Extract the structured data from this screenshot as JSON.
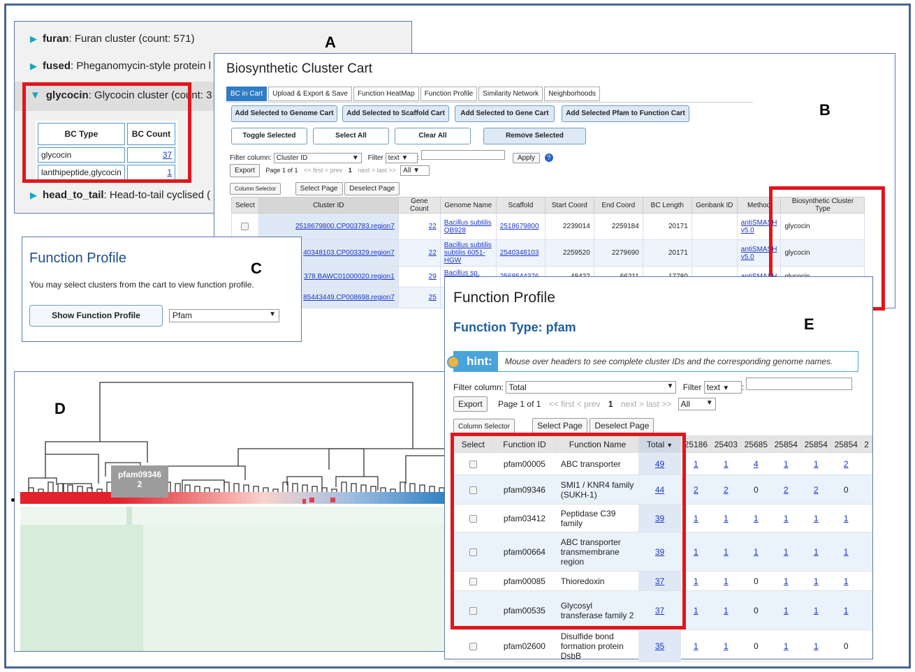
{
  "letters": {
    "a": "A",
    "b": "B",
    "c": "C",
    "d": "D",
    "e": "E"
  },
  "colors": {
    "border": "#4a6690",
    "red": "#e0161c",
    "link": "#1a35c8",
    "accent": "#2f7dc6"
  },
  "panel_a": {
    "rows": [
      {
        "name": "furan",
        "desc": ": Furan cluster (count: 571)"
      },
      {
        "name": "fused",
        "desc": ": Pheganomycin-style protein l"
      },
      {
        "name": "glycocin",
        "desc": ": Glycocin cluster (count: 3"
      },
      {
        "name": "head_to_tail",
        "desc": ": Head-to-tail cyclised ("
      }
    ],
    "table": {
      "headers": [
        "BC Type",
        "BC Count"
      ],
      "rows": [
        [
          "glycocin",
          "37"
        ],
        [
          "lanthipeptide,glycocin",
          "1"
        ]
      ]
    }
  },
  "panel_b": {
    "title": "Biosynthetic Cluster Cart",
    "tabs": [
      "BC in Cart",
      "Upload & Export & Save",
      "Function HeatMap",
      "Function Profile",
      "Similarity Network",
      "Neighborhoods"
    ],
    "buttons": {
      "add_genome": "Add Selected to Genome Cart",
      "add_scaffold": "Add Selected to Scaffold Cart",
      "add_gene": "Add Selected to Gene Cart",
      "add_pfam": "Add Selected Pfam to Function Cart",
      "toggle": "Toggle Selected",
      "select_all": "Select All",
      "clear_all": "Clear All",
      "remove": "Remove Selected"
    },
    "filter": {
      "label": "Filter column:",
      "column": "Cluster ID",
      "filter_label": "Filter",
      "type": "text",
      "apply": "Apply"
    },
    "export": "Export",
    "pager": {
      "page": "Page 1 of 1",
      "first": "<< first",
      "prev": "< prev",
      "num": "1",
      "next": "next >",
      "last": "last >>",
      "show": "All"
    },
    "column_selector": "Column Selector",
    "select_page": "Select Page",
    "deselect_page": "Deselect Page",
    "headers": [
      "Select",
      "Cluster ID",
      "Gene Count",
      "Genome Name",
      "Scaffold",
      "Start Coord",
      "End Coord",
      "BC Length",
      "Genbank ID",
      "Method",
      "Biosynthetic Cluster Type"
    ],
    "rows": [
      {
        "cluster": "2518679800.CP003783.region7",
        "genes": "22",
        "genome": "Bacillus subtilis QB928",
        "scaffold": "2518679800",
        "start": "2239014",
        "end": "2259184",
        "len": "20171",
        "method": "antiSMASH v5.0",
        "type": "glycocin"
      },
      {
        "cluster": "40348103.CP003329.region7",
        "genes": "22",
        "genome": "Bacillus subtilis subtilis 6051-HGW",
        "scaffold": "2540348103",
        "start": "2259520",
        "end": "2279690",
        "len": "20171",
        "method": "antiSMASH v5.0",
        "type": "glycocin"
      },
      {
        "cluster": "378.BAWC01000020.region1",
        "genes": "29",
        "genome": "Bacillus sp. JCM",
        "scaffold": "2568544376",
        "start": "48422",
        "end": "66211",
        "len": "17780",
        "method": "antiSMASH",
        "type": "glycocin"
      },
      {
        "cluster": "85443449.CP008698.region7",
        "genes": "25",
        "genome": "",
        "scaffold": "",
        "start": "",
        "end": "",
        "len": "",
        "method": "",
        "type": ""
      }
    ]
  },
  "panel_c": {
    "title": "Function Profile",
    "text": "You may select clusters from the cart to view function profile.",
    "button": "Show Function Profile",
    "select": "Pfam"
  },
  "panel_d": {
    "tooltip_id": "pfam09346",
    "tooltip_count": "2"
  },
  "panel_e": {
    "title": "Function Profile",
    "subtitle": "Function Type: pfam",
    "hint_label": "hint:",
    "hint_text": "Mouse over headers to see complete cluster IDs and the corresponding genome names.",
    "filter": {
      "label": "Filter column:",
      "column": "Total",
      "filter_label": "Filter",
      "type": "text"
    },
    "export": "Export",
    "pager": {
      "page": "Page 1 of 1",
      "first": "<< first",
      "prev": "< prev",
      "num": "1",
      "next": "next >",
      "last": "last >>",
      "show": "All"
    },
    "column_selector": "Column Selector",
    "select_page": "Select Page",
    "deselect_page": "Deselect Page",
    "headers": [
      "Select",
      "Function ID",
      "Function Name",
      "Total",
      "25186",
      "25403",
      "25685",
      "25854",
      "25854",
      "25854",
      "2"
    ],
    "rows": [
      {
        "id": "pfam00005",
        "name": "ABC transporter",
        "total": "49",
        "v": [
          "1",
          "1",
          "4",
          "1",
          "1",
          "2"
        ]
      },
      {
        "id": "pfam09346",
        "name": "SMI1 / KNR4 family (SUKH-1)",
        "total": "44",
        "v": [
          "2",
          "2",
          "0",
          "2",
          "2",
          "0"
        ]
      },
      {
        "id": "pfam03412",
        "name": "Peptidase C39 family",
        "total": "39",
        "v": [
          "1",
          "1",
          "1",
          "1",
          "1",
          "1"
        ]
      },
      {
        "id": "pfam00664",
        "name": "ABC transporter transmembrane region",
        "total": "39",
        "v": [
          "1",
          "1",
          "1",
          "1",
          "1",
          "1"
        ]
      },
      {
        "id": "pfam00085",
        "name": "Thioredoxin",
        "total": "37",
        "v": [
          "1",
          "1",
          "0",
          "1",
          "1",
          "1"
        ]
      },
      {
        "id": "pfam00535",
        "name": "Glycosyl transferase family 2",
        "total": "37",
        "v": [
          "1",
          "1",
          "0",
          "1",
          "1",
          "1"
        ]
      },
      {
        "id": "pfam02600",
        "name": "Disulfide bond formation protein DsbB",
        "total": "35",
        "v": [
          "1",
          "1",
          "0",
          "1",
          "1",
          "0"
        ]
      }
    ]
  }
}
